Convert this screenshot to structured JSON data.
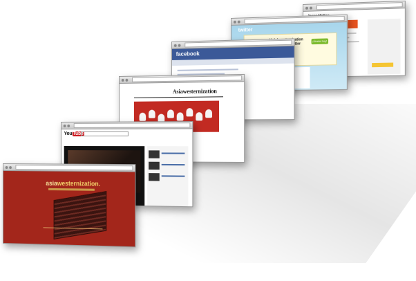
{
  "windows": [
    {
      "id": "red-site",
      "logo_prefix": "asia",
      "logo_main": "westernization."
    },
    {
      "id": "youtube",
      "logo_you": "You",
      "logo_tube": "Tube"
    },
    {
      "id": "blog",
      "title": "Asiawesternization"
    },
    {
      "id": "facebook",
      "logo": "facebook"
    },
    {
      "id": "twitter",
      "logo": "twitter",
      "headline": "¡Hola! westernization está usando Twitter",
      "button": "¡Únete hoy!"
    },
    {
      "id": "profile",
      "name": "Jesus McKee"
    }
  ],
  "colors": {
    "red": "#a3261b",
    "facebook": "#3b5998",
    "youtube": "#cc181e",
    "twitter_sky": "#a8d6ec"
  }
}
